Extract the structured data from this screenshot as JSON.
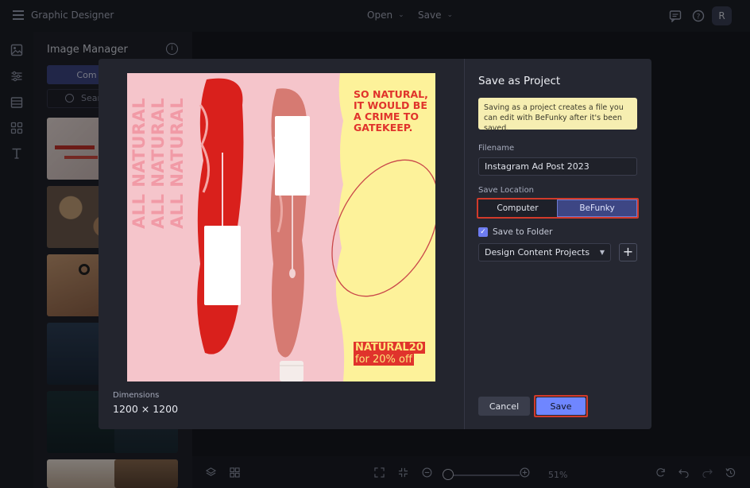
{
  "app": {
    "title": "Graphic Designer"
  },
  "topbar": {
    "open_label": "Open",
    "save_label": "Save",
    "avatar_initial": "R"
  },
  "panel": {
    "title": "Image Manager",
    "tab_label": "Com",
    "search_placeholder": "Sear"
  },
  "bottombar": {
    "zoom_level": "51%"
  },
  "preview": {
    "vertical_text": "ALL NATURAL",
    "headline_lines": [
      "SO NATURAL,",
      "IT WOULD BE",
      "A CRIME TO",
      "GATEKEEP."
    ],
    "promo_code": "NATURAL20",
    "promo_sub": "for 20% off",
    "dimensions_label": "Dimensions",
    "dimensions_value": "1200 × 1200"
  },
  "dialog": {
    "title": "Save as Project",
    "notice": "Saving as a project creates a file you can edit with BeFunky after it's been saved.",
    "filename_label": "Filename",
    "filename_value": "Instagram Ad Post 2023",
    "location_label": "Save Location",
    "location_options": [
      "Computer",
      "BeFunky"
    ],
    "location_selected": "BeFunky",
    "save_to_folder_label": "Save to Folder",
    "save_to_folder_checked": true,
    "folder_value": "Design Content Projects",
    "cancel_label": "Cancel",
    "save_label": "Save"
  },
  "colors": {
    "accent": "#6f86ff",
    "highlight": "#d23a2a",
    "notice_bg": "#f6eeb1",
    "ad_pink": "#f5c5cb",
    "ad_yellow": "#fdf29a",
    "ad_red": "#e0332c"
  },
  "icons": [
    "menu-icon",
    "comment-icon",
    "help-icon",
    "image-icon",
    "sliders-icon",
    "layout-icon",
    "grid-icon",
    "text-icon",
    "info-icon",
    "search-icon",
    "layers-icon",
    "fit-icon",
    "zoom-out-icon",
    "zoom-in-icon",
    "undo-icon",
    "redo-icon",
    "history-icon",
    "plus-icon",
    "chevron-down-icon",
    "check-icon"
  ]
}
